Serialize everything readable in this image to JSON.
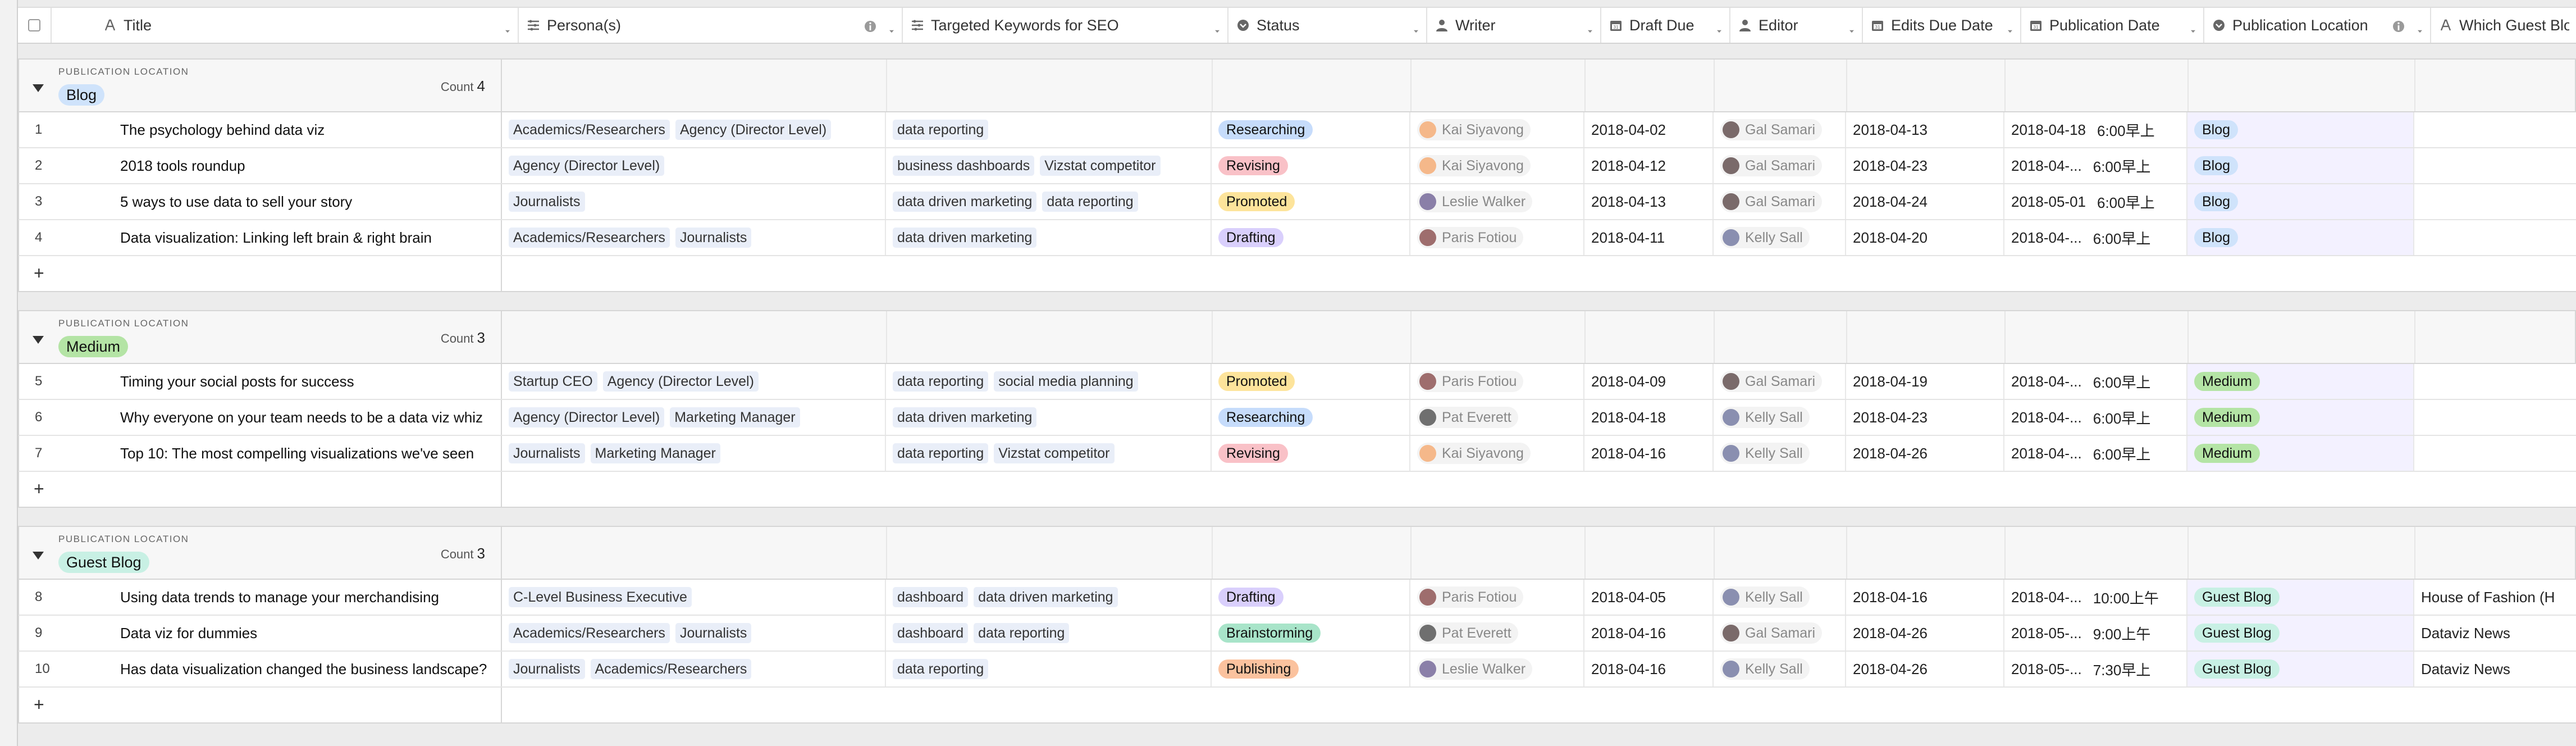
{
  "columns": [
    {
      "key": "title",
      "label": "Title",
      "icon": "text-icon"
    },
    {
      "key": "personas",
      "label": "Persona(s)",
      "icon": "multiselect-icon"
    },
    {
      "key": "keywords",
      "label": "Targeted Keywords for SEO",
      "icon": "multiselect-icon"
    },
    {
      "key": "status",
      "label": "Status",
      "icon": "single-select-icon"
    },
    {
      "key": "writer",
      "label": "Writer",
      "icon": "user-icon"
    },
    {
      "key": "draft_due",
      "label": "Draft Due",
      "icon": "calendar-icon"
    },
    {
      "key": "editor",
      "label": "Editor",
      "icon": "user-icon"
    },
    {
      "key": "edits_due",
      "label": "Edits Due Date",
      "icon": "calendar-icon"
    },
    {
      "key": "pub_date",
      "label": "Publication Date",
      "icon": "calendar-icon"
    },
    {
      "key": "pub_location",
      "label": "Publication Location",
      "icon": "single-select-icon"
    },
    {
      "key": "guest_blog",
      "label": "Which Guest Blog",
      "icon": "text-icon"
    }
  ],
  "group_field_label": "PUBLICATION LOCATION",
  "count_label": "Count",
  "add_row_symbol": "+",
  "colors": {
    "Researching": "#c6dcfb",
    "Revising": "#f9c1c7",
    "Promoted": "#fde49b",
    "Drafting": "#d9cffc",
    "Brainstorming": "#a8e4c9",
    "Publishing": "#fbc29e",
    "Blog": "#cfe3fb",
    "Medium": "#b4e4a5",
    "Guest Blog": "#c8f0e4"
  },
  "groups": [
    {
      "name": "Blog",
      "count": "4",
      "rows": [
        {
          "num": "1",
          "title": "The psychology behind data viz",
          "personas": [
            "Academics/Researchers",
            "Agency (Director Level)"
          ],
          "keywords": [
            "data reporting"
          ],
          "status": "Researching",
          "writer": "Kai Siyavong",
          "writer_avatar": "#f5b88a",
          "draft_due": "2018-04-02",
          "editor": "Gal Samari",
          "editor_avatar": "#7a6a6a",
          "edits_due": "2018-04-13",
          "pub_date": "2018-04-18",
          "pub_time": "6:00早上",
          "pub_location": "Blog",
          "guest_blog": ""
        },
        {
          "num": "2",
          "title": "2018 tools roundup",
          "personas": [
            "Agency (Director Level)"
          ],
          "keywords": [
            "business dashboards",
            "Vizstat competitor"
          ],
          "status": "Revising",
          "writer": "Kai Siyavong",
          "writer_avatar": "#f5b88a",
          "draft_due": "2018-04-12",
          "editor": "Gal Samari",
          "editor_avatar": "#7a6a6a",
          "edits_due": "2018-04-23",
          "pub_date": "2018-04-...",
          "pub_time": "6:00早上",
          "pub_location": "Blog",
          "guest_blog": ""
        },
        {
          "num": "3",
          "title": "5 ways to use data to sell your story",
          "personas": [
            "Journalists"
          ],
          "keywords": [
            "data driven marketing",
            "data reporting"
          ],
          "status": "Promoted",
          "writer": "Leslie Walker",
          "writer_avatar": "#8a7fa8",
          "draft_due": "2018-04-13",
          "editor": "Gal Samari",
          "editor_avatar": "#7a6a6a",
          "edits_due": "2018-04-24",
          "pub_date": "2018-05-01",
          "pub_time": "6:00早上",
          "pub_location": "Blog",
          "guest_blog": ""
        },
        {
          "num": "4",
          "title": "Data visualization: Linking left brain & right brain",
          "personas": [
            "Academics/Researchers",
            "Journalists"
          ],
          "keywords": [
            "data driven marketing"
          ],
          "status": "Drafting",
          "writer": "Paris Fotiou",
          "writer_avatar": "#9e6d6d",
          "draft_due": "2018-04-11",
          "editor": "Kelly Sall",
          "editor_avatar": "#8a8fb0",
          "edits_due": "2018-04-20",
          "pub_date": "2018-04-...",
          "pub_time": "6:00早上",
          "pub_location": "Blog",
          "guest_blog": ""
        }
      ]
    },
    {
      "name": "Medium",
      "count": "3",
      "rows": [
        {
          "num": "5",
          "title": "Timing your social posts for success",
          "personas": [
            "Startup CEO",
            "Agency (Director Level)"
          ],
          "keywords": [
            "data reporting",
            "social media planning"
          ],
          "status": "Promoted",
          "writer": "Paris Fotiou",
          "writer_avatar": "#9e6d6d",
          "draft_due": "2018-04-09",
          "editor": "Gal Samari",
          "editor_avatar": "#7a6a6a",
          "edits_due": "2018-04-19",
          "pub_date": "2018-04-...",
          "pub_time": "6:00早上",
          "pub_location": "Medium",
          "guest_blog": ""
        },
        {
          "num": "6",
          "title": "Why everyone on your team needs to be a data viz whiz",
          "personas": [
            "Agency (Director Level)",
            "Marketing Manager"
          ],
          "keywords": [
            "data driven marketing"
          ],
          "status": "Researching",
          "writer": "Pat Everett",
          "writer_avatar": "#6f6f6f",
          "draft_due": "2018-04-18",
          "editor": "Kelly Sall",
          "editor_avatar": "#8a8fb0",
          "edits_due": "2018-04-23",
          "pub_date": "2018-04-...",
          "pub_time": "6:00早上",
          "pub_location": "Medium",
          "guest_blog": ""
        },
        {
          "num": "7",
          "title": "Top 10: The most compelling visualizations we've seen",
          "personas": [
            "Journalists",
            "Marketing Manager"
          ],
          "keywords": [
            "data reporting",
            "Vizstat competitor"
          ],
          "status": "Revising",
          "writer": "Kai Siyavong",
          "writer_avatar": "#f5b88a",
          "draft_due": "2018-04-16",
          "editor": "Kelly Sall",
          "editor_avatar": "#8a8fb0",
          "edits_due": "2018-04-26",
          "pub_date": "2018-04-...",
          "pub_time": "6:00早上",
          "pub_location": "Medium",
          "guest_blog": ""
        }
      ]
    },
    {
      "name": "Guest Blog",
      "count": "3",
      "rows": [
        {
          "num": "8",
          "title": "Using data trends to manage your merchandising",
          "personas": [
            "C-Level Business Executive"
          ],
          "keywords": [
            "dashboard",
            "data driven marketing"
          ],
          "status": "Drafting",
          "writer": "Paris Fotiou",
          "writer_avatar": "#9e6d6d",
          "draft_due": "2018-04-05",
          "editor": "Kelly Sall",
          "editor_avatar": "#8a8fb0",
          "edits_due": "2018-04-16",
          "pub_date": "2018-04-...",
          "pub_time": "10:00上午",
          "pub_location": "Guest Blog",
          "guest_blog": "House of Fashion (H"
        },
        {
          "num": "9",
          "title": "Data viz for dummies",
          "personas": [
            "Academics/Researchers",
            "Journalists"
          ],
          "keywords": [
            "dashboard",
            "data reporting"
          ],
          "status": "Brainstorming",
          "writer": "Pat Everett",
          "writer_avatar": "#6f6f6f",
          "draft_due": "2018-04-16",
          "editor": "Gal Samari",
          "editor_avatar": "#7a6a6a",
          "edits_due": "2018-04-26",
          "pub_date": "2018-05-...",
          "pub_time": "9:00上午",
          "pub_location": "Guest Blog",
          "guest_blog": "Dataviz News"
        },
        {
          "num": "10",
          "title": "Has data visualization changed the business landscape?",
          "personas": [
            "Journalists",
            "Academics/Researchers"
          ],
          "keywords": [
            "data reporting"
          ],
          "status": "Publishing",
          "writer": "Leslie Walker",
          "writer_avatar": "#8a7fa8",
          "draft_due": "2018-04-16",
          "editor": "Kelly Sall",
          "editor_avatar": "#8a8fb0",
          "edits_due": "2018-04-26",
          "pub_date": "2018-05-...",
          "pub_time": "7:30早上",
          "pub_location": "Guest Blog",
          "guest_blog": "Dataviz News"
        }
      ]
    }
  ]
}
